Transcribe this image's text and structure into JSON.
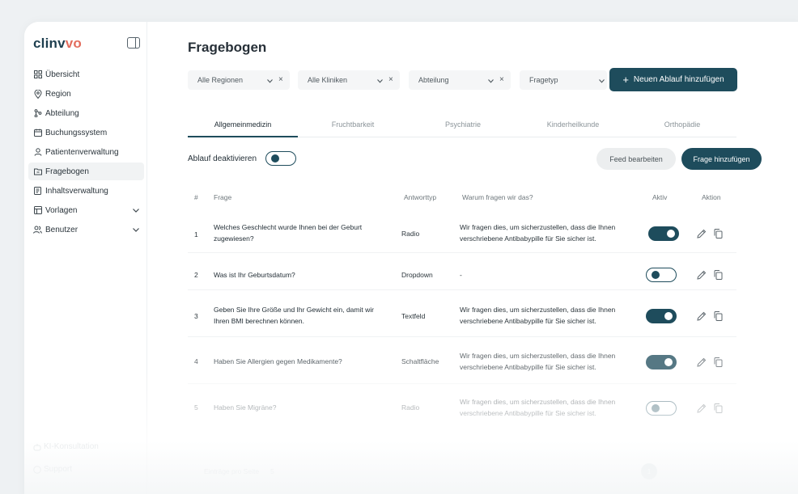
{
  "app": {
    "logo_main": "clinv",
    "logo_accent": "vo"
  },
  "sidebar": {
    "items": [
      {
        "label": "Übersicht",
        "icon": "grid-icon"
      },
      {
        "label": "Region",
        "icon": "map-pin-icon"
      },
      {
        "label": "Abteilung",
        "icon": "branch-icon"
      },
      {
        "label": "Buchungssystem",
        "icon": "calendar-icon"
      },
      {
        "label": "Patientenverwaltung",
        "icon": "user-icon"
      },
      {
        "label": "Fragebogen",
        "icon": "folder-icon",
        "active": true
      },
      {
        "label": "Inhaltsverwaltung",
        "icon": "document-icon"
      },
      {
        "label": "Vorlagen",
        "icon": "table-icon",
        "expandable": true
      },
      {
        "label": "Benutzer",
        "icon": "users-icon",
        "expandable": true
      }
    ],
    "bottom": [
      {
        "label": "KI-Konsultation",
        "icon": "bot-icon"
      },
      {
        "label": "Support",
        "icon": "help-icon"
      }
    ]
  },
  "header": {
    "title": "Fragebogen"
  },
  "filters": [
    {
      "label": "Alle Regionen",
      "clearable": true
    },
    {
      "label": "Alle Kliniken",
      "clearable": true
    },
    {
      "label": "Abteilung",
      "clearable": true
    },
    {
      "label": "Fragetyp",
      "clearable": false
    }
  ],
  "actions": {
    "add_flow": "Neuen Ablauf hinzufügen",
    "edit_feed": "Feed bearbeiten",
    "add_question": "Frage hinzufügen",
    "deactivate_label": "Ablauf deaktivieren",
    "deactivate_state": false
  },
  "tabs": [
    {
      "label": "Allgemeinmedizin",
      "active": true
    },
    {
      "label": "Fruchtbarkeit"
    },
    {
      "label": "Psychiatrie"
    },
    {
      "label": "Kinderheilkunde"
    },
    {
      "label": "Orthopädie"
    }
  ],
  "table": {
    "columns": [
      "#",
      "Frage",
      "Antworttyp",
      "Warum fragen wir das?",
      "Aktiv",
      "Aktion"
    ],
    "rows": [
      {
        "num": "1",
        "question": "Welches Geschlecht wurde Ihnen bei der Geburt zugewiesen?",
        "type": "Radio",
        "reason": "Wir fragen dies, um sicherzustellen, dass die Ihnen verschriebene Antibabypille für Sie sicher ist.",
        "active": true
      },
      {
        "num": "2",
        "question": "Was ist Ihr Geburtsdatum?",
        "type": "Dropdown",
        "reason": "-",
        "active": false
      },
      {
        "num": "3",
        "question": "Geben Sie Ihre Größe und Ihr Gewicht ein, damit wir Ihren BMI berechnen können.",
        "type": "Textfeld",
        "reason": "Wir fragen dies, um sicherzustellen, dass die Ihnen verschriebene Antibabypille für Sie sicher ist.",
        "active": true
      },
      {
        "num": "4",
        "question": "Haben Sie Allergien gegen Medikamente?",
        "type": "Schaltfläche",
        "reason": "Wir fragen dies, um sicherzustellen, dass die Ihnen verschriebene Antibabypille für Sie sicher ist.",
        "active": true
      },
      {
        "num": "5",
        "question": "Haben Sie Migräne?",
        "type": "Radio",
        "reason": "Wir fragen dies, um sicherzustellen, dass die Ihnen verschriebene Antibabypille für Sie sicher ist.",
        "active": false
      }
    ]
  },
  "footer": {
    "rows_per_page": "Einträge pro Seite",
    "rows_value": "5",
    "page": "1"
  },
  "colors": {
    "primary": "#1e4c5c",
    "accent": "#e36d5e"
  }
}
